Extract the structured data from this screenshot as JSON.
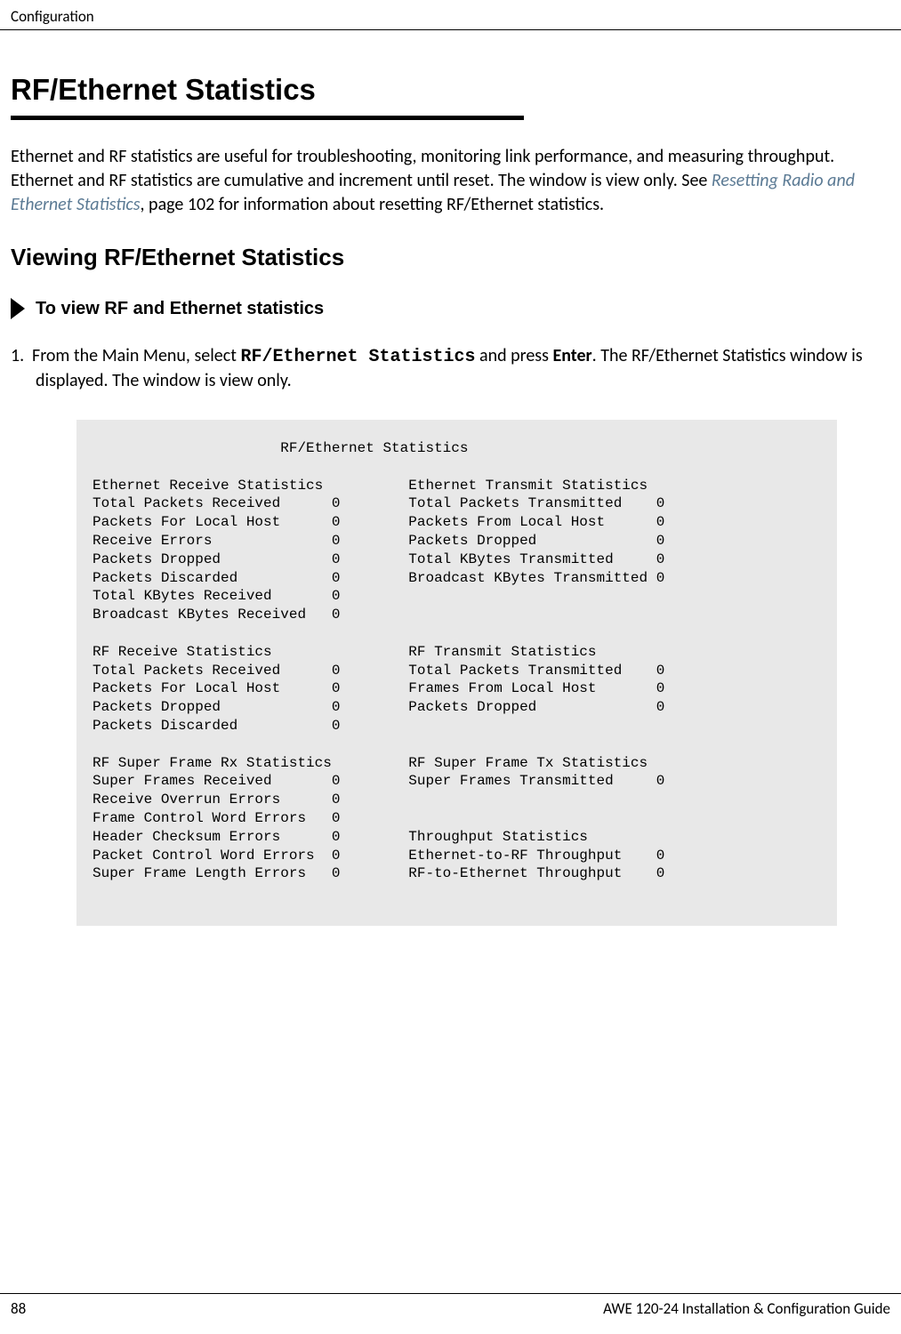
{
  "header": {
    "section": "Configuration"
  },
  "heading": "RF/Ethernet Statistics",
  "intro": {
    "part1": "Ethernet and RF statistics are useful for troubleshooting, monitoring link performance, and measuring throughput. Ethernet and RF statistics are cumulative and increment until reset. The window is view only. See ",
    "link": "Resetting Radio and Ethernet Statistics",
    "part2": ", page 102 for information about resetting RF/Ethernet statistics."
  },
  "subheading": "Viewing RF/Ethernet Statistics",
  "procedure_title": "To view RF and Ethernet statistics",
  "step1": {
    "number": "1.",
    "prefix": "From the Main Menu, select ",
    "menu_item": "RF/Ethernet Statistics",
    "mid": " and press ",
    "key": "Enter",
    "suffix": ". The RF/Ethernet Statistics window is displayed. The window is view only."
  },
  "stats_window": "                      RF/Ethernet Statistics\n\nEthernet Receive Statistics          Ethernet Transmit Statistics\nTotal Packets Received      0        Total Packets Transmitted    0\nPackets For Local Host      0        Packets From Local Host      0\nReceive Errors              0        Packets Dropped              0\nPackets Dropped             0        Total KBytes Transmitted     0\nPackets Discarded           0        Broadcast KBytes Transmitted 0\nTotal KBytes Received       0\nBroadcast KBytes Received   0\n\nRF Receive Statistics                RF Transmit Statistics\nTotal Packets Received      0        Total Packets Transmitted    0\nPackets For Local Host      0        Frames From Local Host       0\nPackets Dropped             0        Packets Dropped              0\nPackets Discarded           0\n\nRF Super Frame Rx Statistics         RF Super Frame Tx Statistics\nSuper Frames Received       0        Super Frames Transmitted     0\nReceive Overrun Errors      0\nFrame Control Word Errors   0\nHeader Checksum Errors      0        Throughput Statistics\nPacket Control Word Errors  0        Ethernet-to-RF Throughput    0\nSuper Frame Length Errors   0        RF-to-Ethernet Throughput    0",
  "footer": {
    "page": "88",
    "title": "AWE 120-24 Installation & Configuration Guide"
  }
}
